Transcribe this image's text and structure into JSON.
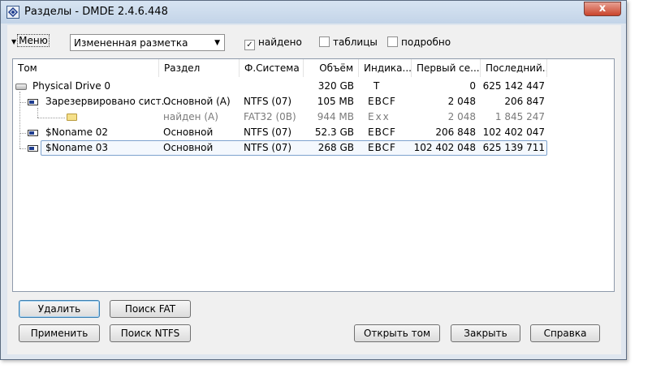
{
  "window": {
    "title": "Разделы - DMDE 2.4.6.448",
    "close_label": "x"
  },
  "toolbar": {
    "menu_label": "Меню",
    "combo_value": "Измененная разметка",
    "checkboxes": [
      {
        "label": "найдено",
        "checked": true
      },
      {
        "label": "таблицы",
        "checked": false
      },
      {
        "label": "подробно",
        "checked": false
      }
    ]
  },
  "list": {
    "columns": [
      "Том",
      "Раздел",
      "Ф.Система",
      "Объём",
      "Индика...",
      "Первый се...",
      "Последний..."
    ],
    "rows": [
      {
        "name": "Physical Drive 0",
        "section": "",
        "fs": "",
        "size": "320 GB",
        "ind": "T",
        "first": "0",
        "last": "625 142 447",
        "dim": false
      },
      {
        "name": "Зарезервировано сист...",
        "section": "Основной (A)",
        "fs": "NTFS (07)",
        "size": "105 MB",
        "ind": "EBCF",
        "first": "2 048",
        "last": "206 847",
        "dim": false
      },
      {
        "name": "",
        "section": "найден (A)",
        "fs": "FAT32 (0B)",
        "size": "944 MB",
        "ind": "Exx",
        "first": "2 048",
        "last": "1 845 247",
        "dim": true
      },
      {
        "name": "$Noname 02",
        "section": "Основной",
        "fs": "NTFS (07)",
        "size": "52.3 GB",
        "ind": "EBCF",
        "first": "206 848",
        "last": "102 402 047",
        "dim": false
      },
      {
        "name": "$Noname 03",
        "section": "Основной",
        "fs": "NTFS (07)",
        "size": "268 GB",
        "ind": "EBCF",
        "first": "102 402 048",
        "last": "625 139 711",
        "dim": false
      }
    ]
  },
  "buttons": {
    "delete": "Удалить",
    "search_fat": "Поиск FAT",
    "apply": "Применить",
    "search_ntfs": "Поиск NTFS",
    "open_volume": "Открыть том",
    "close": "Закрыть",
    "help": "Справка"
  }
}
